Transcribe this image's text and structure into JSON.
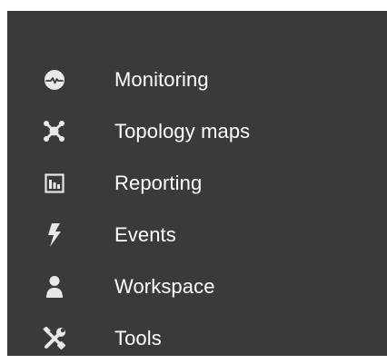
{
  "sidebar": {
    "items": [
      {
        "label": "Monitoring",
        "icon": "heartbeat-icon"
      },
      {
        "label": "Topology maps",
        "icon": "topology-icon"
      },
      {
        "label": "Reporting",
        "icon": "report-chart-icon"
      },
      {
        "label": "Events",
        "icon": "lightning-bolt-icon"
      },
      {
        "label": "Workspace",
        "icon": "user-icon"
      },
      {
        "label": "Tools",
        "icon": "wrench-screwdriver-icon"
      }
    ]
  },
  "colors": {
    "sidebar_background": "#3a3a3a",
    "text": "#ffffff",
    "icon": "#e8e8e8"
  }
}
